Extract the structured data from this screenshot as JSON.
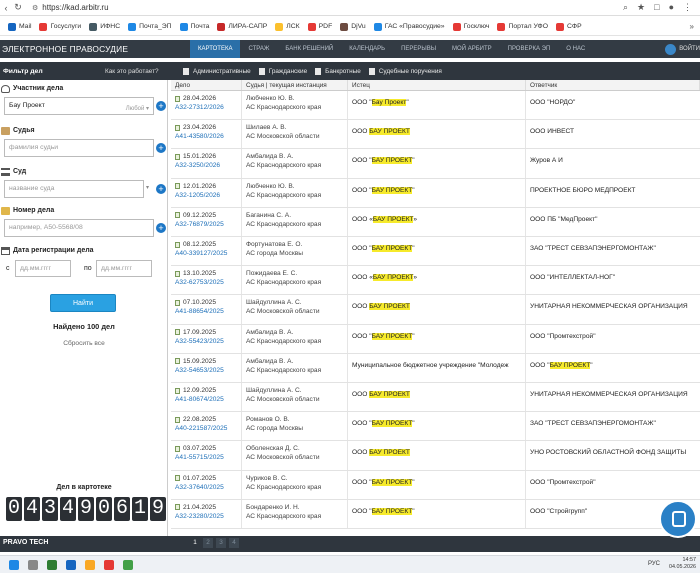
{
  "browser": {
    "url": "https://kad.arbitr.ru",
    "bookmarks": [
      {
        "label": "Mail",
        "color": "#1565c0"
      },
      {
        "label": "Госуслуги",
        "color": "#e53935"
      },
      {
        "label": "ИФНС",
        "color": "#455a64"
      },
      {
        "label": "Почта_ЭП",
        "color": "#1e88e5"
      },
      {
        "label": "Почта",
        "color": "#1e88e5"
      },
      {
        "label": "ЛИРА-САПР",
        "color": "#c62828"
      },
      {
        "label": "ЛСК",
        "color": "#fbc02d"
      },
      {
        "label": "PDF",
        "color": "#e53935"
      },
      {
        "label": "DjVu",
        "color": "#6d4c41"
      },
      {
        "label": "ГАС «Правосудие»",
        "color": "#1e88e5"
      },
      {
        "label": "Госключ",
        "color": "#e53935"
      },
      {
        "label": "Портал УФО",
        "color": "#e53935"
      },
      {
        "label": "СФР",
        "color": "#e53935"
      }
    ]
  },
  "header": {
    "brand": "ЭЛЕКТРОННОЕ ПРАВОСУДИЕ",
    "menu": [
      "КАРТОТЕКА",
      "СТРАЖ",
      "БАНК РЕШЕНИЙ",
      "КАЛЕНДАРЬ",
      "ПЕРЕРЫВЫ",
      "МОЙ АРБИТР",
      "ПРОВЕРКА ЭП",
      "О НАС"
    ],
    "login": "ВОЙТИ"
  },
  "filterbar": {
    "title": "Фильтр дел",
    "how": "Как это работает?",
    "types": [
      "Административные",
      "Гражданские",
      "Банкротные",
      "Судебные поручения"
    ]
  },
  "sidebar": {
    "participant_label": "Участник дела",
    "participant_value": "Бау Проект",
    "participant_role": "Любой",
    "judge_label": "Судья",
    "judge_placeholder": "фамилия судьи",
    "court_label": "Суд",
    "court_placeholder": "название суда",
    "case_label": "Номер дела",
    "case_placeholder": "например, А50-5568/08",
    "date_label": "Дата регистрации дела",
    "from": "с",
    "to": "по",
    "date_placeholder": "дд.мм.гггг",
    "find_button": "Найти",
    "found": "Найдено 100 дел",
    "reset": "Сбросить все",
    "counter_label": "Дел в картотеке",
    "counter": [
      "0",
      "4",
      "3",
      "4",
      "9",
      "0",
      "6",
      "1",
      "9"
    ]
  },
  "table": {
    "headers": [
      "Дело",
      "Судья | текущая инстанция",
      "Истец",
      "Ответчик"
    ],
    "rows": [
      {
        "date": "28.04.2026",
        "num": "А32-27312/2026",
        "judge": "Любченко Ю. В.",
        "court": "АС Краснодарского края",
        "plaintiff_pre": "ООО \"",
        "plaintiff_hl": "Бау Проект",
        "plaintiff_post": "\"",
        "defendant_pre": "ООО \"НОРДО\"",
        "defendant_hl": "",
        "defendant_post": ""
      },
      {
        "date": "23.04.2026",
        "num": "А41-43580/2026",
        "judge": "Шилаев А. В.",
        "court": "АС Московской области",
        "plaintiff_pre": "ООО ",
        "plaintiff_hl": "БАУ ПРОЕКТ",
        "plaintiff_post": "",
        "defendant_pre": "ООО ИНВЕСТ",
        "defendant_hl": "",
        "defendant_post": ""
      },
      {
        "date": "15.01.2026",
        "num": "А32-3250/2026",
        "judge": "Амбалида В. А.",
        "court": "АС Краснодарского края",
        "plaintiff_pre": "ООО \"",
        "plaintiff_hl": "БАУ ПРОЕКТ",
        "plaintiff_post": "\"",
        "defendant_pre": "Журов А И",
        "defendant_hl": "",
        "defendant_post": ""
      },
      {
        "date": "12.01.2026",
        "num": "А32-1205/2026",
        "judge": "Любченко Ю. В.",
        "court": "АС Краснодарского края",
        "plaintiff_pre": "ООО \"",
        "plaintiff_hl": "БАУ ПРОЕКТ",
        "plaintiff_post": "\"",
        "defendant_pre": "ПРОЕКТНОЕ БЮРО МЕДПРОЕКТ",
        "defendant_hl": "",
        "defendant_post": ""
      },
      {
        "date": "09.12.2025",
        "num": "А32-76879/2025",
        "judge": "Баганина С. А.",
        "court": "АС Краснодарского края",
        "plaintiff_pre": "ООО «",
        "plaintiff_hl": "БАУ ПРОЕКТ",
        "plaintiff_post": "»",
        "defendant_pre": "ООО ПБ \"МедПроект\"",
        "defendant_hl": "",
        "defendant_post": ""
      },
      {
        "date": "08.12.2025",
        "num": "А40-339127/2025",
        "judge": "Фортунатова Е. О.",
        "court": "АС города Москвы",
        "plaintiff_pre": "ООО \"",
        "plaintiff_hl": "БАУ ПРОЕКТ",
        "plaintiff_post": "\"",
        "defendant_pre": "ЗАО \"ТРЕСТ СЕВЗАПЭНЕРГОМОНТАЖ\"",
        "defendant_hl": "",
        "defendant_post": ""
      },
      {
        "date": "13.10.2025",
        "num": "А32-62753/2025",
        "judge": "Пожидаева Е. С.",
        "court": "АС Краснодарского края",
        "plaintiff_pre": "ООО «",
        "plaintiff_hl": "БАУ ПРОЕКТ",
        "plaintiff_post": "»",
        "defendant_pre": "ООО \"ИНТЕЛЛЕКТАЛ-НОГ\"",
        "defendant_hl": "",
        "defendant_post": ""
      },
      {
        "date": "07.10.2025",
        "num": "А41-88654/2025",
        "judge": "Шайдуллина А. С.",
        "court": "АС Московской области",
        "plaintiff_pre": "ООО ",
        "plaintiff_hl": "БАУ ПРОЕКТ",
        "plaintiff_post": "",
        "defendant_pre": "УНИТАРНАЯ НЕКОММЕРЧЕСКАЯ ОРГАНИЗАЦИЯ",
        "defendant_hl": "",
        "defendant_post": ""
      },
      {
        "date": "17.09.2025",
        "num": "А32-55423/2025",
        "judge": "Амбалида В. А.",
        "court": "АС Краснодарского края",
        "plaintiff_pre": "ООО \"",
        "plaintiff_hl": "БАУ ПРОЕКТ",
        "plaintiff_post": "\"",
        "defendant_pre": "ООО \"Промтехстрой\"",
        "defendant_hl": "",
        "defendant_post": ""
      },
      {
        "date": "15.09.2025",
        "num": "А32-54653/2025",
        "judge": "Амбалида В. А.",
        "court": "АС Краснодарского края",
        "plaintiff_pre": "Муниципальное бюджетное учреждение \"Молодеж",
        "plaintiff_hl": "",
        "plaintiff_post": "",
        "defendant_pre": "ООО \"",
        "defendant_hl": "БАУ ПРОЕКТ",
        "defendant_post": "\""
      },
      {
        "date": "12.09.2025",
        "num": "А41-80674/2025",
        "judge": "Шайдуллина А. С.",
        "court": "АС Московской области",
        "plaintiff_pre": "ООО ",
        "plaintiff_hl": "БАУ ПРОЕКТ",
        "plaintiff_post": "",
        "defendant_pre": "УНИТАРНАЯ НЕКОММЕРЧЕСКАЯ ОРГАНИЗАЦИЯ",
        "defendant_hl": "",
        "defendant_post": ""
      },
      {
        "date": "22.08.2025",
        "num": "А40-221587/2025",
        "judge": "Романов О. В.",
        "court": "АС города Москвы",
        "plaintiff_pre": "ООО \"",
        "plaintiff_hl": "БАУ ПРОЕКТ",
        "plaintiff_post": "\"",
        "defendant_pre": "ЗАО \"ТРЕСТ СЕВЗАПЭНЕРГОМОНТАЖ\"",
        "defendant_hl": "",
        "defendant_post": ""
      },
      {
        "date": "03.07.2025",
        "num": "А41-55715/2025",
        "judge": "Оболенская Д. С.",
        "court": "АС Московской области",
        "plaintiff_pre": "ООО ",
        "plaintiff_hl": "БАУ ПРОЕКТ",
        "plaintiff_post": "",
        "defendant_pre": "УНО РОСТОВСКИЙ ОБЛАСТНОЙ ФОНД ЗАЩИТЫ",
        "defendant_hl": "",
        "defendant_post": ""
      },
      {
        "date": "01.07.2025",
        "num": "А32-37640/2025",
        "judge": "Чуриков В. С.",
        "court": "АС Краснодарского края",
        "plaintiff_pre": "ООО \"",
        "plaintiff_hl": "БАУ ПРОЕКТ",
        "plaintiff_post": "\"",
        "defendant_pre": "ООО \"Промтехстрой\"",
        "defendant_hl": "",
        "defendant_post": ""
      },
      {
        "date": "21.04.2025",
        "num": "А32-23280/2025",
        "judge": "Бондаренко И. Н.",
        "court": "АС Краснодарского края",
        "plaintiff_pre": "ООО \"",
        "plaintiff_hl": "БАУ ПРОЕКТ",
        "plaintiff_post": "\"",
        "defendant_pre": "ООО \"Стройгрупп\"",
        "defendant_hl": "",
        "defendant_post": ""
      }
    ]
  },
  "footer": {
    "brand": "PRAVO TECH",
    "pages": [
      "1",
      "2",
      "3",
      "4"
    ]
  },
  "taskbar": {
    "tray": "РУС",
    "time": "14:57",
    "date": "04.05.2026"
  }
}
